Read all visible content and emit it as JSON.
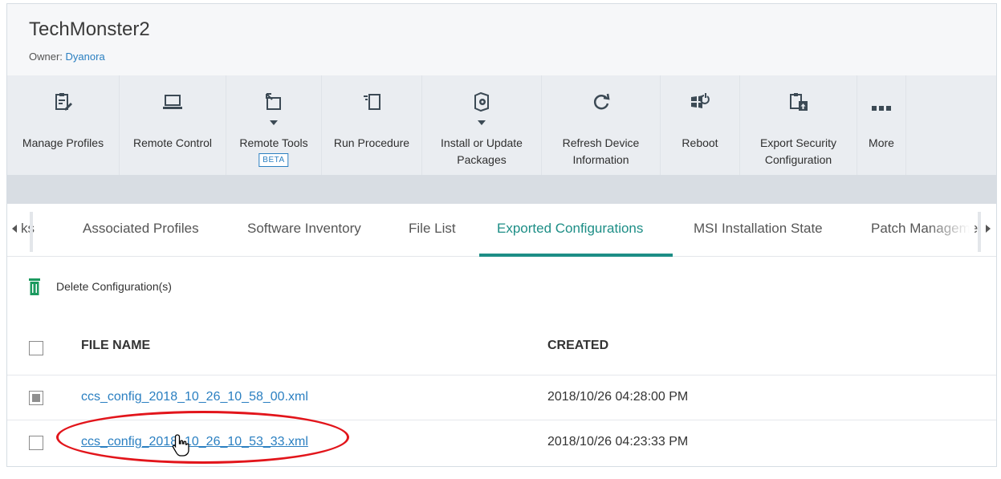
{
  "device": {
    "title": "TechMonster2",
    "owner_label": "Owner:",
    "owner_name": "Dyanora"
  },
  "toolbar": {
    "manage_profiles": "Manage Profiles",
    "remote_control": "Remote Control",
    "remote_tools": "Remote Tools",
    "remote_tools_badge": "BETA",
    "run_procedure": "Run Procedure",
    "install_line1": "Install or Update",
    "install_line2": "Packages",
    "refresh_line1": "Refresh Device",
    "refresh_line2": "Information",
    "reboot": "Reboot",
    "export_line1": "Export Security",
    "export_line2": "Configuration",
    "more": "More"
  },
  "tabs": {
    "partial_left": "ks",
    "associated_profiles": "Associated Profiles",
    "software_inventory": "Software Inventory",
    "file_list": "File List",
    "exported_configurations": "Exported Configurations",
    "msi_installation_state": "MSI Installation State",
    "patch_management_partial": "Patch Manageme",
    "active": "Exported Configurations"
  },
  "actions": {
    "delete": "Delete Configuration(s)"
  },
  "table": {
    "headers": {
      "file_name": "FILE NAME",
      "created": "CREATED"
    },
    "rows": [
      {
        "file_name": "ccs_config_2018_10_26_10_58_00.xml",
        "created": "2018/10/26 04:28:00 PM",
        "checked": true
      },
      {
        "file_name": "ccs_config_2018_10_26_10_53_33.xml",
        "created": "2018/10/26 04:23:33 PM",
        "checked": false
      }
    ]
  },
  "colors": {
    "accent_teal": "#1d8e86",
    "link_blue": "#2a7fc1",
    "annotation_red": "#e2151b",
    "trash_green": "#1b9a5f"
  }
}
